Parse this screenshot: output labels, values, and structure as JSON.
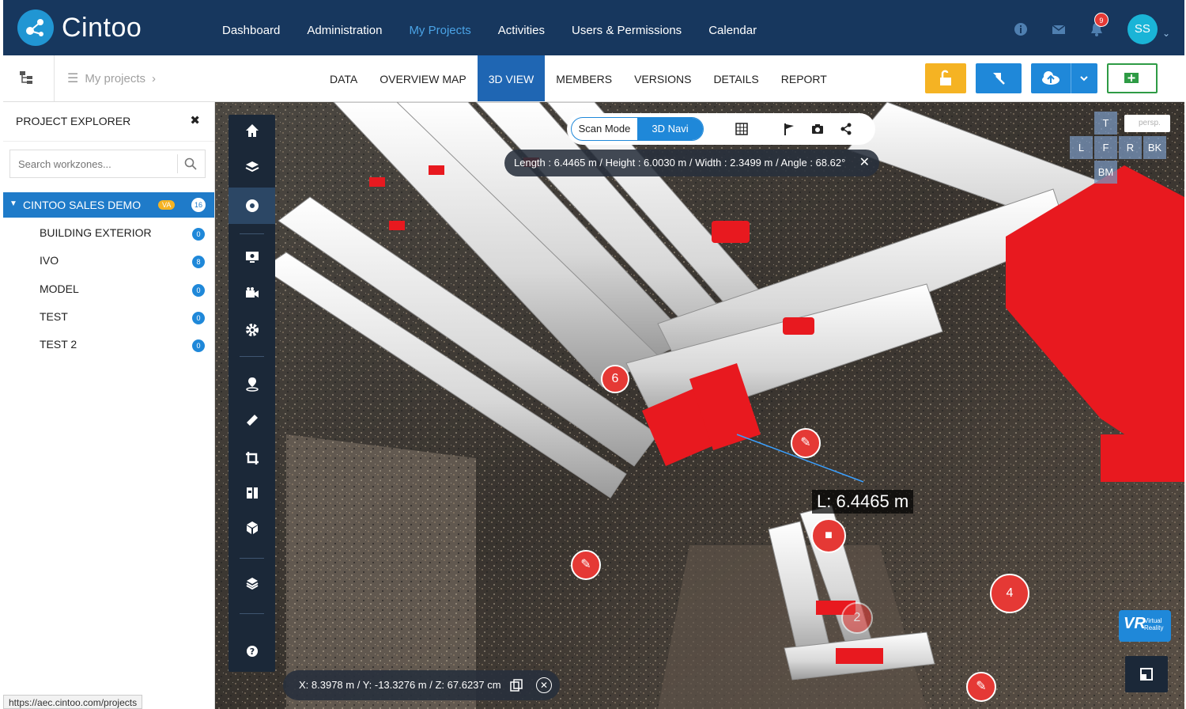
{
  "app": {
    "name": "Cintoo"
  },
  "nav": {
    "items": [
      "Dashboard",
      "Administration",
      "My Projects",
      "Activities",
      "Users & Permissions",
      "Calendar"
    ],
    "active_index": 2
  },
  "header": {
    "notification_count": "9",
    "user_initials": "SS"
  },
  "breadcrumb": {
    "label": "My projects"
  },
  "tabs": {
    "items": [
      "DATA",
      "OVERVIEW MAP",
      "3D VIEW",
      "MEMBERS",
      "VERSIONS",
      "DETAILS",
      "REPORT"
    ],
    "active_index": 2
  },
  "sidebar": {
    "title": "PROJECT EXPLORER",
    "search_placeholder": "Search workzones...",
    "root": {
      "name": "CINTOO SALES DEMO",
      "badge": "VA",
      "count": "16"
    },
    "items": [
      {
        "name": "BUILDING EXTERIOR",
        "count": "0"
      },
      {
        "name": "IVO",
        "count": "8"
      },
      {
        "name": "MODEL",
        "count": "0"
      },
      {
        "name": "TEST",
        "count": "0"
      },
      {
        "name": "TEST 2",
        "count": "0"
      }
    ]
  },
  "viewer": {
    "mode": {
      "scan": "Scan Mode",
      "navi": "3D Navi",
      "active": "3D Navi"
    },
    "measurement": "Length : 6.4465 m  /  Height : 6.0030 m  /  Width : 2.3499 m  /  Angle : 68.62°",
    "length_label": "L: 6.4465 m",
    "coordinates": "X: 8.3978 m / Y: -13.3276 m / Z: 67.6237 cm",
    "view_cube": {
      "top": "T",
      "left": "L",
      "front": "F",
      "right": "R",
      "back": "BK",
      "bottom": "BM"
    },
    "projection": "persp.",
    "vr": {
      "big": "VR",
      "small_1": "Virtual",
      "small_2": "Reality"
    },
    "markers": [
      "6",
      "4",
      "2"
    ]
  },
  "status_url": "https://aec.cintoo.com/projects",
  "colors": {
    "header_bg": "#17375e",
    "accent": "#1f88d9",
    "active_tab": "#1f66b3",
    "warning_btn": "#f5b323",
    "marker": "#e53935"
  }
}
